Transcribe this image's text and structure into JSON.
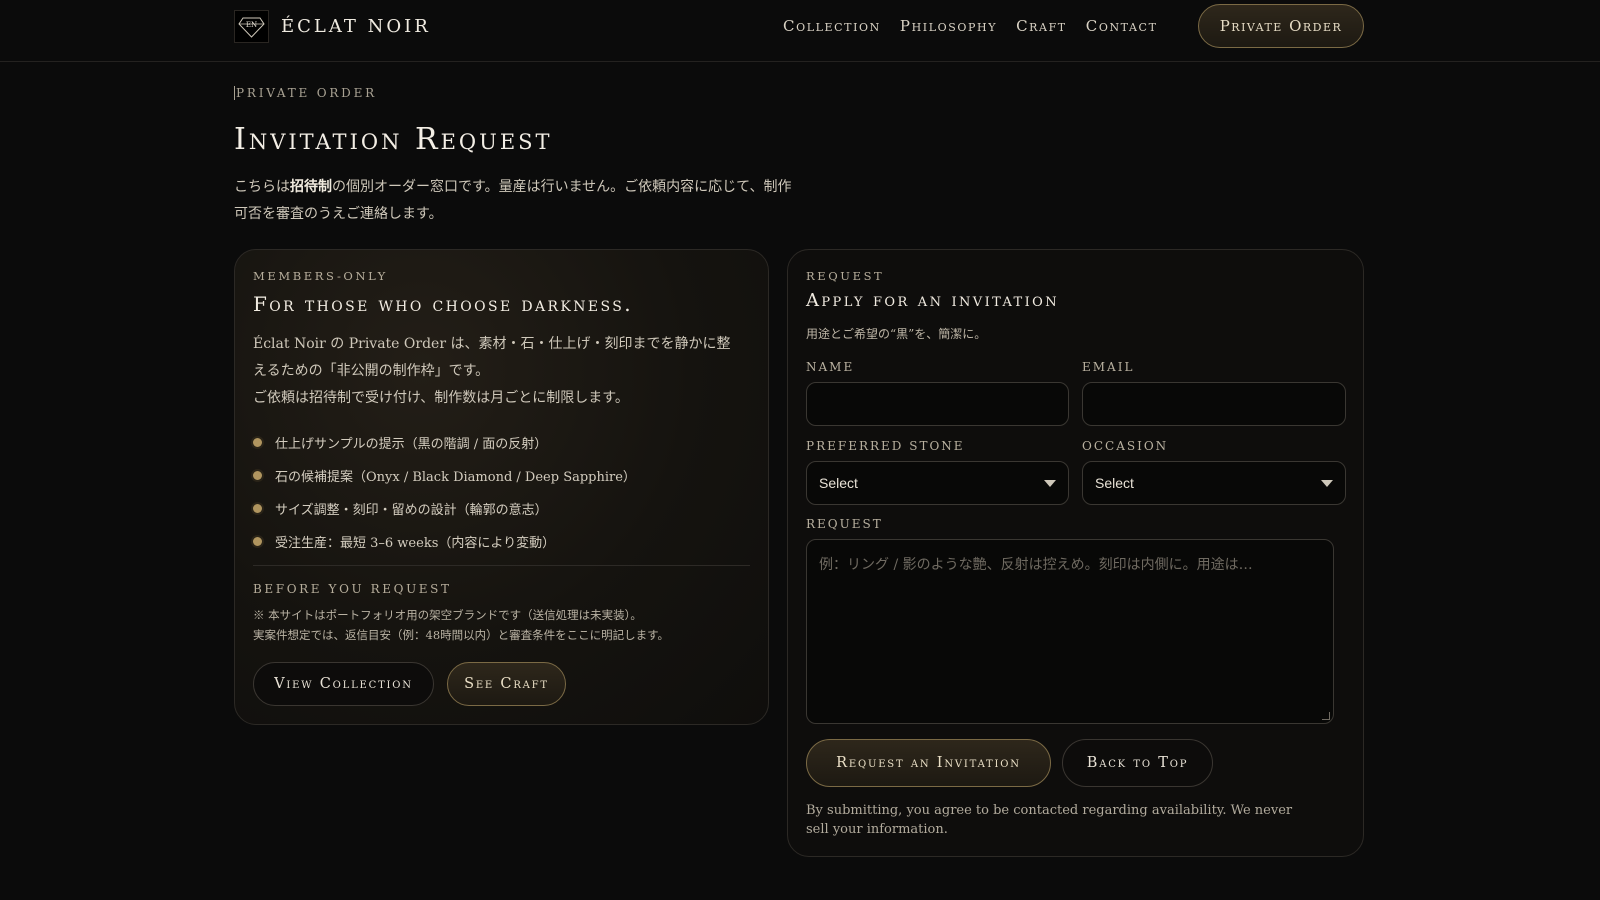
{
  "header": {
    "brand_name": "ÉCLAT NOIR",
    "brand_logo_text": "EN",
    "nav": [
      "Collection",
      "Philosophy",
      "Craft",
      "Contact"
    ],
    "cta_label": "Private Order"
  },
  "intro": {
    "eyebrow": "Private Order",
    "title": "Invitation Request",
    "text_before": "こちらは",
    "text_bold": "招待制",
    "text_after": "の個別オーダー窓口です。量産は行いません。ご依頼内容に応じて、制作可否を審査のうえご連絡します。"
  },
  "left_panel": {
    "eyebrow": "Members-Only",
    "title": "For those who choose darkness.",
    "text1": "Éclat Noir の Private Order は、素材・石・仕上げ・刻印までを静かに整えるための「非公開の制作枠」です。",
    "text2": "ご依頼は招待制で受け付け、制作数は月ごとに制限します。",
    "bullets": [
      "仕上げサンプルの提示（黒の階調 / 面の反射）",
      "石の候補提案（Onyx / Black Diamond / Deep Sapphire）",
      "サイズ調整・刻印・留めの設計（輪郭の意志）",
      "受注生産：最短 3–6 weeks（内容により変動）"
    ],
    "before_label": "Before You Request",
    "note1": "※ 本サイトはポートフォリオ用の架空ブランドです（送信処理は未実装）。",
    "note2": "実案件想定では、返信目安（例：48時間以内）と審査条件をここに明記します。",
    "btn_collection": "View Collection",
    "btn_craft": "See Craft"
  },
  "form": {
    "eyebrow": "Request",
    "title": "Apply for an invitation",
    "subtitle": "用途とご希望の“黒”を、簡潔に。",
    "name_label": "Name",
    "name_value": "",
    "email_label": "Email",
    "email_value": "",
    "stone_label": "Preferred Stone",
    "stone_value": "Select",
    "occasion_label": "Occasion",
    "occasion_value": "Select",
    "request_label": "Request",
    "request_placeholder": "例：リング / 影のような艶、反射は控えめ。刻印は内側に。用途は…",
    "submit_label": "Request an Invitation",
    "back_label": "Back to Top",
    "footnote": "By submitting, you agree to be contacted regarding availability. We never sell your information."
  },
  "colors": {
    "background": "#0b0b0b",
    "gold_accent": "#b0955f",
    "text": "#e8e2d6"
  }
}
